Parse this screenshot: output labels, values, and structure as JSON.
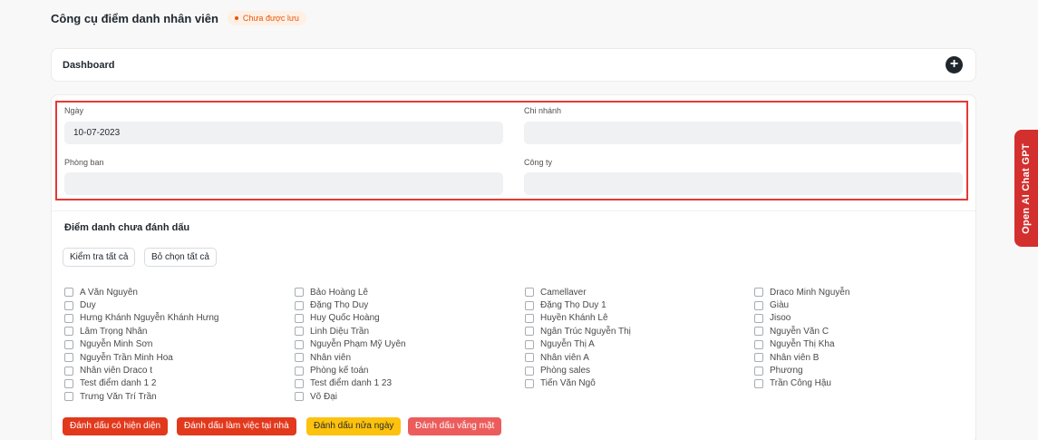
{
  "page": {
    "title": "Công cụ điểm danh nhân viên",
    "status": "Chưa được lưu"
  },
  "dashboard": {
    "label": "Dashboard",
    "add_icon": "+"
  },
  "filters": {
    "date_label": "Ngày",
    "date_value": "10-07-2023",
    "branch_label": "Chi nhánh",
    "branch_value": "",
    "department_label": "Phòng ban",
    "department_value": "",
    "company_label": "Công ty",
    "company_value": ""
  },
  "unmarked": {
    "title": "Điểm danh chưa đánh dấu",
    "check_all": "Kiểm tra tất cả",
    "uncheck_all": "Bỏ chọn tất cả",
    "columns": [
      [
        "A Văn Nguyên",
        "Duy",
        "Hưng Khánh Nguyễn Khánh Hưng",
        "Lâm Trọng Nhân",
        "Nguyễn Minh Sơn",
        "Nguyễn Trần Minh Hoa",
        "Nhân viên Draco t",
        "Test điểm danh 1 2",
        "Trưng Văn Trí Trần"
      ],
      [
        "Bảo Hoàng Lê",
        "Đặng Thọ Duy",
        "Huy Quốc Hoàng",
        "Linh Diệu Trần",
        "Nguyễn Phạm Mỹ Uyên",
        "Nhân viên",
        "Phòng kế toán",
        "Test điểm danh 1 23",
        "Võ Đại"
      ],
      [
        "Camellaver",
        "Đặng Thọ Duy 1",
        "Huyền Khánh Lê",
        "Ngân Trúc Nguyễn Thị",
        "Nguyễn Thị A",
        "Nhân viên A",
        "Phòng sales",
        "Tiến Văn Ngô"
      ],
      [
        "Draco Minh Nguyễn",
        "Giàu",
        "Jisoo",
        "Nguyễn Văn C",
        "Nguyễn Thị Kha",
        "Nhân viên B",
        "Phương",
        "Trần Công Hậu"
      ]
    ]
  },
  "actions": {
    "present": "Đánh dấu có hiện diện",
    "wfh": "Đánh dấu làm việc tại nhà",
    "half_day": "Đánh dấu nửa ngày",
    "absent": "Đánh dấu vắng mặt"
  },
  "side_tab": {
    "label": "Open AI Chat GPT"
  },
  "colors": {
    "highlight": "#e53935",
    "btn_red": "#e2391d",
    "btn_yellow": "#fcc20d",
    "btn_pink": "#ec5c5c",
    "side_tab": "#d32f2f"
  }
}
